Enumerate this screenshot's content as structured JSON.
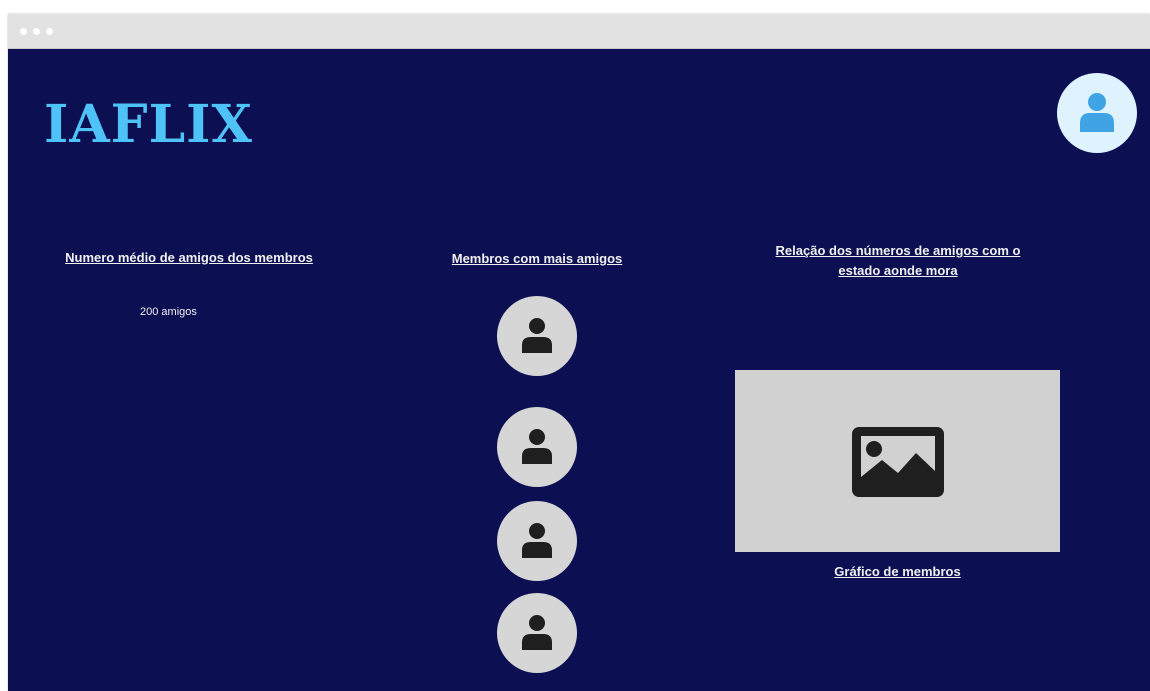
{
  "app": {
    "logo": "IAFLIX"
  },
  "header": {
    "profile_icon": "user-icon"
  },
  "average_friends": {
    "title": "Numero médio de amigos dos membros",
    "value": "200 amigos"
  },
  "top_members": {
    "title": "Membros com mais amigos",
    "members": [
      {
        "icon": "user-icon"
      },
      {
        "icon": "user-icon"
      },
      {
        "icon": "user-icon"
      },
      {
        "icon": "user-icon"
      }
    ]
  },
  "relation": {
    "title_line1": "Relação dos números de amigos com o",
    "title_line2": "estado aonde mora",
    "image_icon": "image-icon",
    "caption": "Gráfico de membros"
  },
  "colors": {
    "background": "#0c0f52",
    "logo": "#4fc3f7",
    "profile_bg": "#dff3ff",
    "profile_icon": "#3fa3e4",
    "member_bg": "#d6d6d6",
    "placeholder_bg": "#d1d1d1",
    "icon_dark": "#1f1f1f"
  }
}
